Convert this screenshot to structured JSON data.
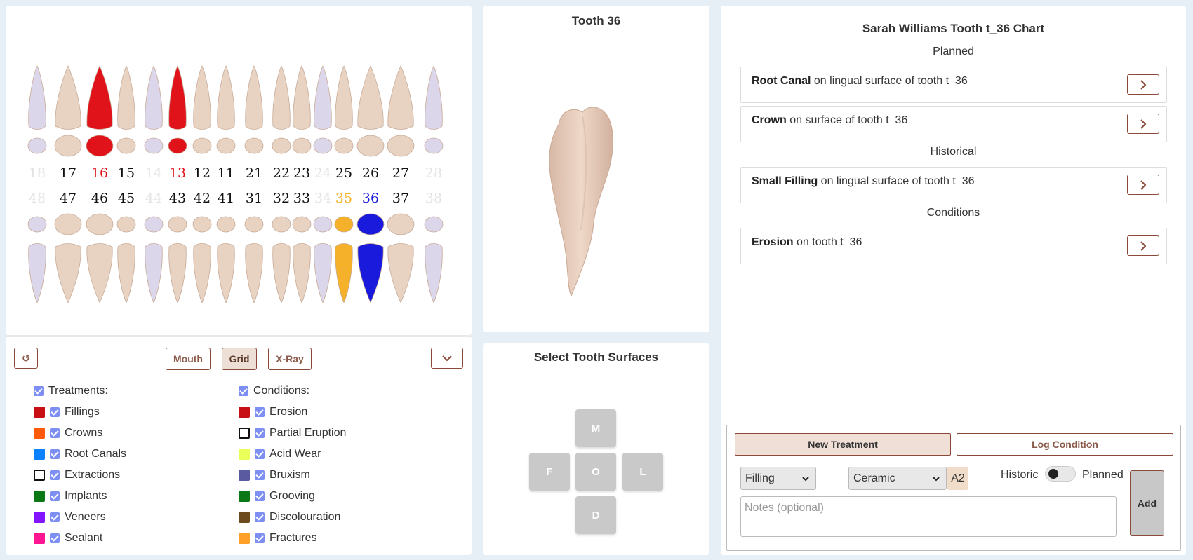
{
  "chart": {
    "upper_numbers": [
      {
        "n": "18",
        "state": "dim"
      },
      {
        "n": "17",
        "state": "normal"
      },
      {
        "n": "16",
        "state": "red"
      },
      {
        "n": "15",
        "state": "normal"
      },
      {
        "n": "14",
        "state": "dim"
      },
      {
        "n": "13",
        "state": "red"
      },
      {
        "n": "12",
        "state": "normal"
      },
      {
        "n": "11",
        "state": "normal"
      },
      {
        "n": "21",
        "state": "normal"
      },
      {
        "n": "22",
        "state": "normal"
      },
      {
        "n": "23",
        "state": "normal"
      },
      {
        "n": "24",
        "state": "dim"
      },
      {
        "n": "25",
        "state": "normal"
      },
      {
        "n": "26",
        "state": "normal"
      },
      {
        "n": "27",
        "state": "normal"
      },
      {
        "n": "28",
        "state": "dim"
      }
    ],
    "lower_numbers": [
      {
        "n": "48",
        "state": "dim"
      },
      {
        "n": "47",
        "state": "normal"
      },
      {
        "n": "46",
        "state": "normal"
      },
      {
        "n": "45",
        "state": "normal"
      },
      {
        "n": "44",
        "state": "dim"
      },
      {
        "n": "43",
        "state": "normal"
      },
      {
        "n": "42",
        "state": "normal"
      },
      {
        "n": "41",
        "state": "normal"
      },
      {
        "n": "31",
        "state": "normal"
      },
      {
        "n": "32",
        "state": "normal"
      },
      {
        "n": "33",
        "state": "normal"
      },
      {
        "n": "34",
        "state": "dim"
      },
      {
        "n": "35",
        "state": "orange"
      },
      {
        "n": "36",
        "state": "blue"
      },
      {
        "n": "37",
        "state": "normal"
      },
      {
        "n": "38",
        "state": "dim"
      }
    ],
    "colors": {
      "normal": "#111111",
      "dim": "#e2e2e2",
      "red": "#e0131b",
      "orange": "#f5b12a",
      "blue": "#1a1adc",
      "tooth": "#e8d3c2",
      "tooth_missing": "#dcd6ea"
    }
  },
  "controls": {
    "reset_icon": "↺",
    "view_buttons": [
      "Mouth",
      "Grid",
      "X-Ray"
    ],
    "active_view": "Grid",
    "treatments_header": "Treatments:",
    "conditions_header": "Conditions:",
    "treatments": [
      {
        "label": "Fillings",
        "color": "#c80f14"
      },
      {
        "label": "Crowns",
        "color": "#ff5a0a"
      },
      {
        "label": "Root Canals",
        "color": "#0a82ff"
      },
      {
        "label": "Extractions",
        "color": "outline"
      },
      {
        "label": "Implants",
        "color": "#0a7814"
      },
      {
        "label": "Veneers",
        "color": "#8214ff"
      },
      {
        "label": "Sealant",
        "color": "#ff1491"
      }
    ],
    "conditions": [
      {
        "label": "Erosion",
        "color": "#c80f14"
      },
      {
        "label": "Partial Eruption",
        "color": "outline"
      },
      {
        "label": "Acid Wear",
        "color": "#eaff5a"
      },
      {
        "label": "Bruxism",
        "color": "#5a5aa0"
      },
      {
        "label": "Grooving",
        "color": "#0a7814"
      },
      {
        "label": "Discolouration",
        "color": "#6e4b1e"
      },
      {
        "label": "Fractures",
        "color": "#ffa028"
      }
    ]
  },
  "tooth_view": {
    "title": "Tooth 36"
  },
  "surfaces": {
    "title": "Select Tooth Surfaces",
    "buttons": [
      "M",
      "F",
      "O",
      "L",
      "D"
    ]
  },
  "right": {
    "title": "Sarah Williams Tooth t_36 Chart",
    "sections": {
      "planned": "Planned",
      "historical": "Historical",
      "conditions": "Conditions"
    },
    "planned": [
      {
        "name": "Root Canal",
        "desc": " on lingual surface of tooth t_36"
      },
      {
        "name": "Crown",
        "desc": " on surface of tooth t_36"
      }
    ],
    "historical": [
      {
        "name": "Small Filling",
        "desc": " on lingual surface of tooth t_36"
      }
    ],
    "conditions_list": [
      {
        "name": "Erosion",
        "desc": " on tooth t_36"
      }
    ]
  },
  "form": {
    "new_treatment": "New Treatment",
    "log_condition": "Log Condition",
    "type_value": "Filling",
    "material_value": "Ceramic",
    "shade": "A2",
    "historic_label": "Historic",
    "planned_label": "Planned",
    "notes_placeholder": "Notes (optional)",
    "add": "Add"
  }
}
